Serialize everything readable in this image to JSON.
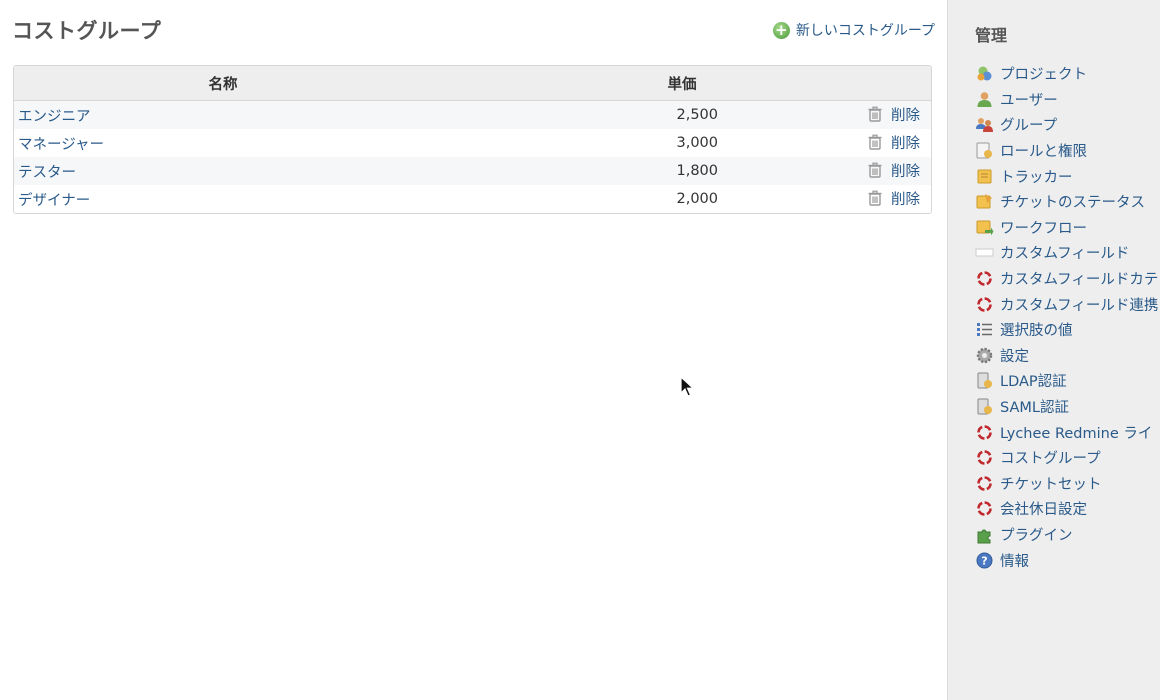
{
  "page": {
    "title": "コストグループ",
    "new_link": "新しいコストグループ"
  },
  "table": {
    "headers": [
      "名称",
      "単価",
      ""
    ],
    "rows": [
      {
        "name": "エンジニア",
        "price": "2,500",
        "action": "削除"
      },
      {
        "name": "マネージャー",
        "price": "3,000",
        "action": "削除"
      },
      {
        "name": "テスター",
        "price": "1,800",
        "action": "削除"
      },
      {
        "name": "デザイナー",
        "price": "2,000",
        "action": "削除"
      }
    ]
  },
  "sidebar": {
    "title": "管理",
    "items": [
      {
        "label": "プロジェクト",
        "icon": "projects-icon"
      },
      {
        "label": "ユーザー",
        "icon": "user-icon"
      },
      {
        "label": "グループ",
        "icon": "group-icon"
      },
      {
        "label": "ロールと権限",
        "icon": "roles-icon"
      },
      {
        "label": "トラッカー",
        "icon": "tracker-icon"
      },
      {
        "label": "チケットのステータス",
        "icon": "issue-status-icon"
      },
      {
        "label": "ワークフロー",
        "icon": "workflow-icon"
      },
      {
        "label": "カスタムフィールド",
        "icon": "custom-field-icon"
      },
      {
        "label": "カスタムフィールドカテ",
        "icon": "lychee-icon"
      },
      {
        "label": "カスタムフィールド連携",
        "icon": "lychee-icon"
      },
      {
        "label": "選択肢の値",
        "icon": "list-icon"
      },
      {
        "label": "設定",
        "icon": "gear-icon"
      },
      {
        "label": "LDAP認証",
        "icon": "server-auth-icon"
      },
      {
        "label": "SAML認証",
        "icon": "server-auth-icon"
      },
      {
        "label": "Lychee Redmine ライ",
        "icon": "lychee-icon"
      },
      {
        "label": "コストグループ",
        "icon": "lychee-icon"
      },
      {
        "label": "チケットセット",
        "icon": "lychee-icon"
      },
      {
        "label": "会社休日設定",
        "icon": "lychee-icon"
      },
      {
        "label": "プラグイン",
        "icon": "plugin-icon"
      },
      {
        "label": "情報",
        "icon": "help-icon"
      }
    ]
  },
  "colors": {
    "link": "#2a5a8a",
    "sidebar_bg": "#eeeeee",
    "header_bg": "#eeeeee",
    "lychee_red": "#c0282d"
  }
}
